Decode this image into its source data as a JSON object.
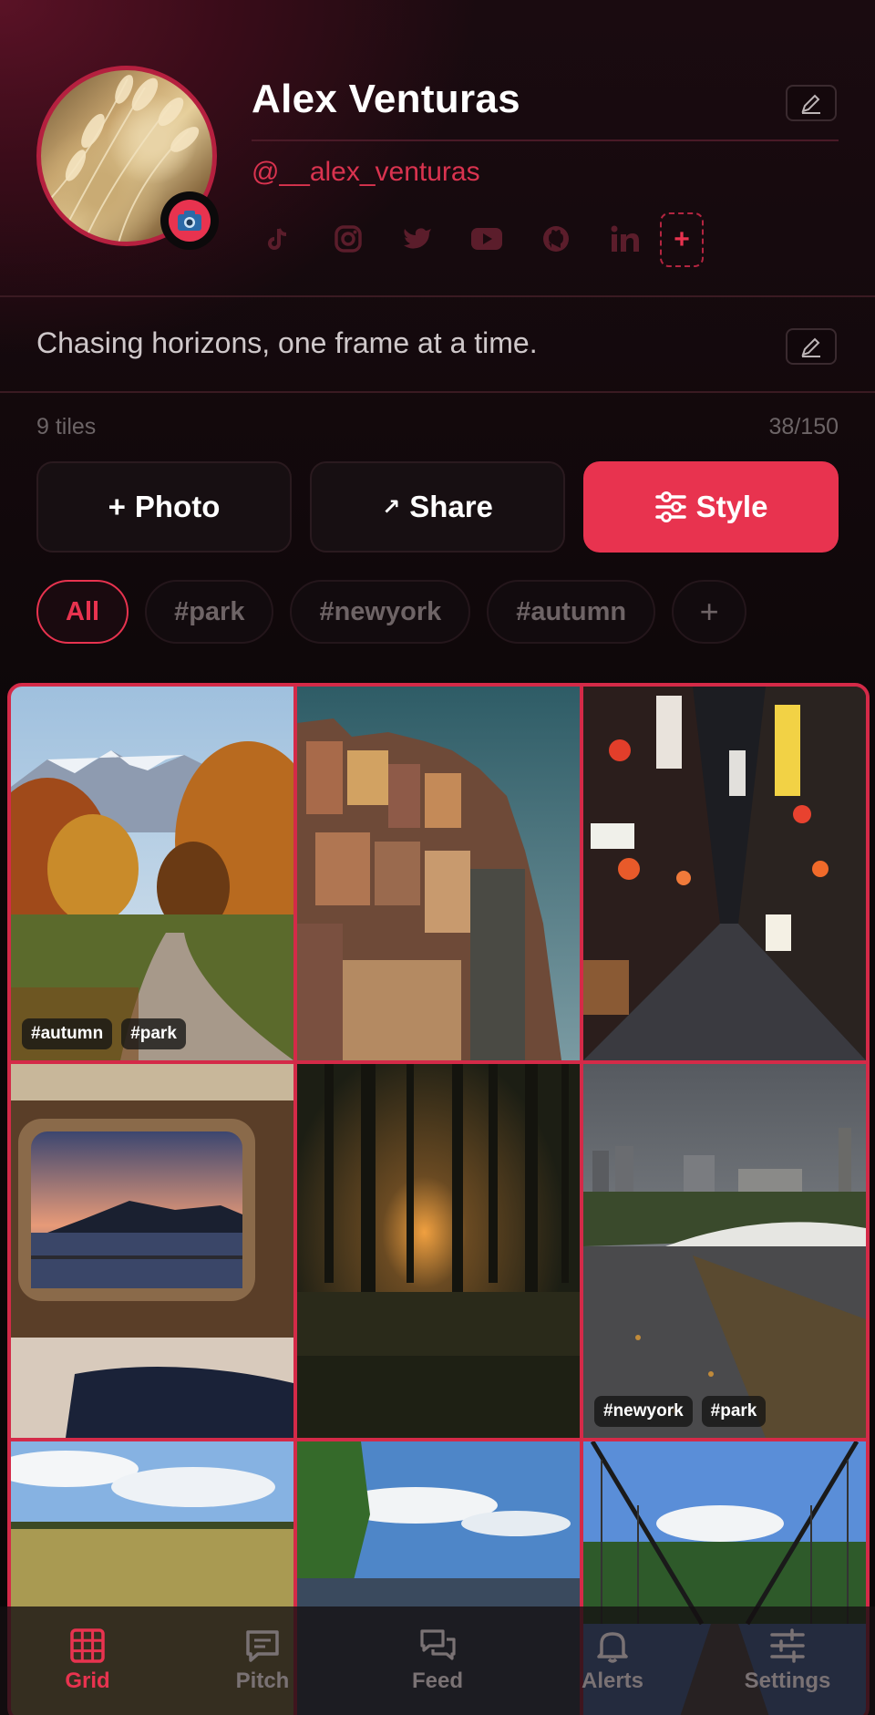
{
  "profile": {
    "name": "Alex Venturas",
    "handle": "@__alex_venturas",
    "bio": "Chasing horizons, one frame at a time.",
    "socials": [
      "tiktok-icon",
      "instagram-icon",
      "twitter-icon",
      "youtube-icon",
      "github-icon",
      "linkedin-icon"
    ],
    "social_add": "+"
  },
  "stats": {
    "tiles": "9 tiles",
    "counter": "38/150"
  },
  "actions": {
    "photo_symbol": "+",
    "photo": "Photo",
    "share_symbol": "↗",
    "share": "Share",
    "style": "Style"
  },
  "filters": [
    "All",
    "#park",
    "#newyork",
    "#autumn"
  ],
  "filter_add": "+",
  "grid": {
    "tiles": [
      {
        "scene": "autumn park path with snowy mountains",
        "tags": [
          "#autumn",
          "#park"
        ]
      },
      {
        "scene": "colorful cliffside town",
        "tags": []
      },
      {
        "scene": "neon Tokyo alley at night",
        "tags": []
      },
      {
        "scene": "train window sunset over harbor",
        "tags": []
      },
      {
        "scene": "sunset through forest",
        "tags": []
      },
      {
        "scene": "rainy Central Park with skyline",
        "tags": [
          "#newyork",
          "#park"
        ]
      },
      {
        "scene": "wheat field under clouds",
        "tags": []
      },
      {
        "scene": "lake with clouds",
        "tags": []
      },
      {
        "scene": "suspension bridge in forest",
        "tags": []
      }
    ]
  },
  "nav": {
    "items": [
      {
        "label": "Grid",
        "icon": "grid-icon",
        "active": true
      },
      {
        "label": "Pitch",
        "icon": "message-icon",
        "active": false
      },
      {
        "label": "Feed",
        "icon": "chat-icon",
        "active": false
      },
      {
        "label": "Alerts",
        "icon": "bell-icon",
        "active": false
      },
      {
        "label": "Settings",
        "icon": "sliders-icon",
        "active": false
      }
    ]
  },
  "colors": {
    "accent": "#e8334f",
    "background": "#0b0709"
  }
}
